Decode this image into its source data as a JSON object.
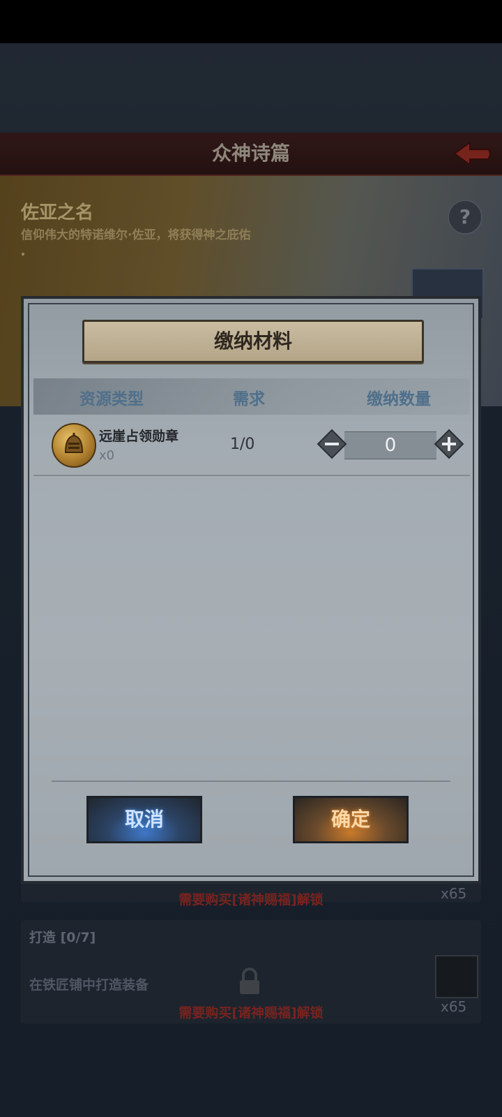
{
  "background": {
    "header_title": "众神诗篇",
    "banner_title": "佐亚之名",
    "banner_subtitle": "信仰伟大的特诺维尔·佐亚，将获得神之庇佑",
    "tasks": [
      {
        "lock_text": "需要购买[诸神赐福]解锁",
        "reward_count": "x65"
      },
      {
        "title": "打造 [0/7]",
        "description": "在铁匠铺中打造装备",
        "lock_text": "需要购买[诸神赐福]解锁",
        "reward_count": "x65"
      }
    ]
  },
  "modal": {
    "title": "缴纳材料",
    "columns": {
      "type": "资源类型",
      "need": "需求",
      "quantity": "缴纳数量"
    },
    "items": [
      {
        "name": "远崖占领勋章",
        "owned": "x0",
        "need": "1/0",
        "quantity": "0",
        "icon": "medal-icon"
      }
    ],
    "cancel_label": "取消",
    "confirm_label": "确定"
  },
  "colors": {
    "cancel_glow": "#3f78c8",
    "confirm_glow": "#c97a2a",
    "lock_text": "#8d2a25",
    "header_text": "#4f6f8a"
  }
}
